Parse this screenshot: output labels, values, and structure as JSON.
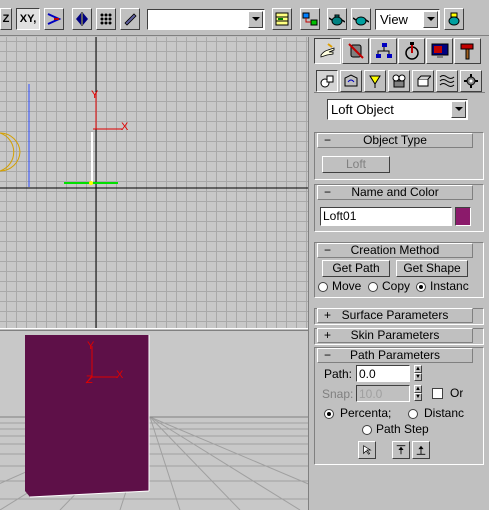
{
  "toolbar": {
    "axis_z": "Z",
    "axis_xy": "XY,",
    "selection_set_value": "",
    "view_label": "View"
  },
  "panel": {
    "object_category": "Loft Object",
    "rollouts": {
      "object_type": {
        "sign": "−",
        "title": "Object Type",
        "loft_button": "Loft"
      },
      "name_color": {
        "sign": "−",
        "title": "Name and Color",
        "name_value": "Loft01",
        "color": "#8b1a6b"
      },
      "creation_method": {
        "sign": "−",
        "title": "Creation Method",
        "get_path": "Get Path",
        "get_shape": "Get Shape",
        "options": [
          "Move",
          "Copy",
          "Instanc"
        ],
        "selected": "Instanc"
      },
      "surface_parameters": {
        "sign": "+",
        "title": "Surface Parameters"
      },
      "skin_parameters": {
        "sign": "+",
        "title": "Skin Parameters"
      },
      "path_parameters": {
        "sign": "−",
        "title": "Path Parameters",
        "path_label": "Path:",
        "path_value": "0.0",
        "snap_label": "Snap:",
        "snap_value": "10.0",
        "snap_on_label": "Or",
        "percentage_label": "Percenta;",
        "distance_label": "Distanc",
        "path_steps_label": "Path Step",
        "selected": "Percenta;"
      }
    }
  },
  "viewport_top": {
    "axis_x": "X",
    "axis_y": "Y"
  },
  "viewport_persp": {
    "axis_x": "X",
    "axis_y": "Y",
    "axis_z": "Z",
    "object_color": "#5e1048"
  }
}
